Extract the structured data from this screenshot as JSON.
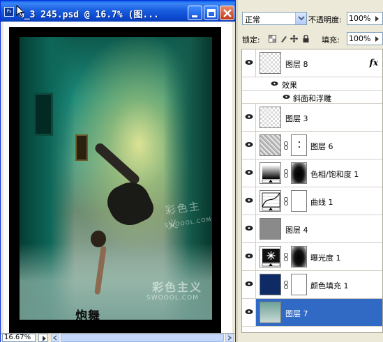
{
  "document": {
    "title": "G_3 245.psd @ 16.7% (图...",
    "app_icon_text": "Ps",
    "zoom": "16.67%",
    "photo_logo": "炮舞",
    "watermark_1": "彩色主义",
    "watermark_2": "SWOOOL.COM",
    "watermark_3": "彩色主义",
    "watermark_4": "SWOOOL.COM"
  },
  "layers_panel": {
    "blend_mode": "正常",
    "opacity_label": "不透明度:",
    "opacity_value": "100%",
    "lock_label": "锁定:",
    "fill_label": "填充:",
    "fill_value": "100%",
    "effects_label": "效果",
    "effect_item": "斜面和浮雕",
    "fx_label": "fx",
    "layers": [
      {
        "name": "图层 8",
        "thumb": "transparent",
        "has_fx": true
      },
      {
        "name": "图层 3",
        "thumb": "transparent"
      },
      {
        "name": "图层 6",
        "thumb": "noise",
        "mask": "dots"
      },
      {
        "name": "色相/饱和度 1",
        "thumb": "adjustment-hue",
        "mask": "dark"
      },
      {
        "name": "曲线 1",
        "thumb": "adjustment-curves",
        "mask": "white"
      },
      {
        "name": "图层 4",
        "thumb": "gray"
      },
      {
        "name": "曝光度 1",
        "thumb": "adjustment-exposure",
        "mask": "dark"
      },
      {
        "name": "颜色填充 1",
        "thumb": "navy",
        "mask": "white"
      },
      {
        "name": "图层 7",
        "thumb": "photo",
        "selected": true
      }
    ]
  },
  "colors": {
    "titlebar": "#0b48cf",
    "selection": "#316ac5",
    "panel_bg": "#ece9d8"
  }
}
